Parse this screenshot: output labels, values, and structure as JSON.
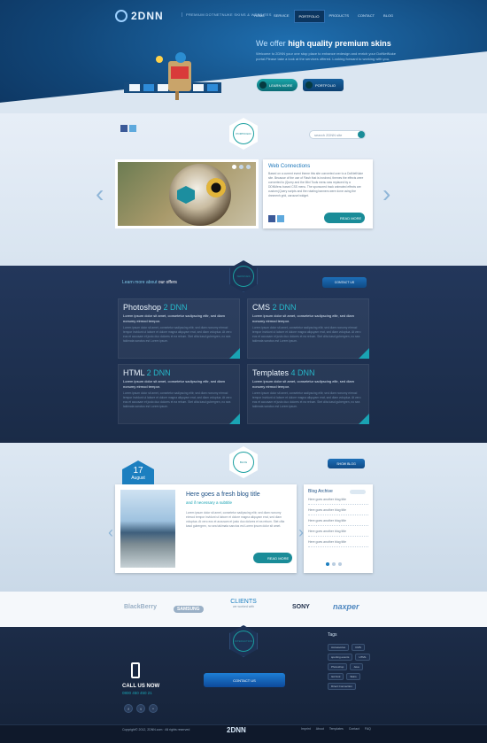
{
  "brand": {
    "name": "2DNN",
    "tagline": "PREMIUM DOTNETNUKE SKINS & WEBSITES"
  },
  "nav": [
    "HOME",
    "SERVICE",
    "PORTFOLIO",
    "PRODUCTS",
    "CONTACT",
    "BLOG"
  ],
  "hero": {
    "title_pre": "We offer ",
    "title_bold": "high quality premium skins",
    "text": "Welcome to 2DNN your one stop place to enhance redesign and enrich your DotNetNuke portal.Please take a look at the services offered. Looking forward to working with you.",
    "learn_more": "LEARN MORE",
    "portfolio": "PORTFOLIO"
  },
  "portfolio": {
    "hex_label": "PORTFOLIO",
    "search_placeholder": "search 2DNN site",
    "info_title": "Web Connections",
    "info_text": "Based on a current event theme this site converted over to a DotNetNuke site. Because of the use of Flash that is involved, themes the effects were converted to jQuery and the Mini Tools menu was replaced by a DDNMenu based CSS menu. The sponsored track animated effects are custom jQuery scripts and the rotating banners were done using the dnnmenh grid, carousel widget.",
    "read_more": "READ MORE"
  },
  "services": {
    "hex_label": "SERVICES",
    "learn_pre": "Learn more about ",
    "learn_bold": "our offers",
    "contact_btn": "CONTACT US",
    "cards": [
      {
        "t1": "Photoshop ",
        "t2": "2 DNN",
        "lead": "Lorem ipsum dolor sit amet, consetetur sadipscing elitr, sed diam nonumy eirmod tempor.",
        "text": "Lorem ipsum dolor sit amet, consetetur sadipscing elitr, sed diam nonumy eirmod tempor invidunt ut labore et dolore magna aliquyam erat, sed diam voluptua. At vero eos et accusam et justo duo dolores et ea rebum. Stet clita kasd gubergren, no sea takimata sanctus est Lorem ipsum."
      },
      {
        "t1": "CMS ",
        "t2": "2 DNN",
        "lead": "Lorem ipsum dolor sit amet, consetetur sadipscing elitr, sed diam nonumy eirmod tempor.",
        "text": "Lorem ipsum dolor sit amet, consetetur sadipscing elitr, sed diam nonumy eirmod tempor invidunt ut labore et dolore magna aliquyam erat, sed diam voluptua. At vero eos et accusam et justo duo dolores et ea rebum. Stet clita kasd gubergren, no sea takimata sanctus est Lorem ipsum."
      },
      {
        "t1": "HTML ",
        "t2": "2 DNN",
        "lead": "Lorem ipsum dolor sit amet, consetetur sadipscing elitr, sed diam nonumy eirmod tempor.",
        "text": "Lorem ipsum dolor sit amet, consetetur sadipscing elitr, sed diam nonumy eirmod tempor invidunt ut labore et dolore magna aliquyam erat, sed diam voluptua. At vero eos et accusam et justo duo dolores et ea rebum. Stet clita kasd gubergren, no sea takimata sanctus est Lorem ipsum."
      },
      {
        "t1": "Templates ",
        "t2": "4 DNN",
        "lead": "Lorem ipsum dolor sit amet, consetetur sadipscing elitr, sed diam nonumy eirmod tempor.",
        "text": "Lorem ipsum dolor sit amet, consetetur sadipscing elitr, sed diam nonumy eirmod tempor invidunt ut labore et dolore magna aliquyam erat, sed diam voluptua. At vero eos et accusam et justo duo dolores et ea rebum. Stet clita kasd gubergren, no sea takimata sanctus est Lorem ipsum."
      }
    ]
  },
  "blog": {
    "hex_label": "BLOG",
    "date_day": "17",
    "date_month": "August",
    "show_blog": "SHOW BLOG",
    "title": "Here goes a fresh blog title",
    "subtitle": "and if necessary a subtitle",
    "text": "Lorem ipsum dolor sit amet, consetetur sadipscing elitr, sed diam nonumy eirmod tempor invidunt ut labore et dolore magna aliquyam erat, sed diam voluptua. At vero eos et accusam et justo duo dolores et ea rebum. Stet clita kasd gubergren, no sea takimata sanctus est Lorem ipsum dolor sit amet.",
    "read_more": "READ MORE",
    "archive_title": "Blog Archive",
    "archive_items": [
      "Here goes another blog title",
      "Here goes another blog title",
      "Here goes another blog title",
      "Here goes another blog title",
      "Here goes another blog title"
    ]
  },
  "clients": {
    "title": "CLIENTS",
    "subtitle": "we worked with",
    "logos": [
      "BlackBerry",
      "SAMSUNG",
      "SONY",
      "naxper"
    ]
  },
  "footer": {
    "hex_label": "INTERACTION",
    "call_us": "CALL US NOW",
    "phone": "0800 450 450 21",
    "social": [
      "f",
      "t",
      "^"
    ],
    "contact_ribbon": "CONTACT US",
    "tags_title": "Tags",
    "tags": [
      "Accessories",
      "CMS",
      "sporting events",
      "HTML",
      "Photoshop",
      "Java",
      "Git html",
      "Skins",
      "Direct Connection"
    ],
    "copyright": "Copyright© 2012, 2DNN.com · All rights reserved",
    "logo": "2DNN",
    "links": [
      "Imprint",
      "About",
      "Templates",
      "Contact",
      "FAQ"
    ]
  }
}
